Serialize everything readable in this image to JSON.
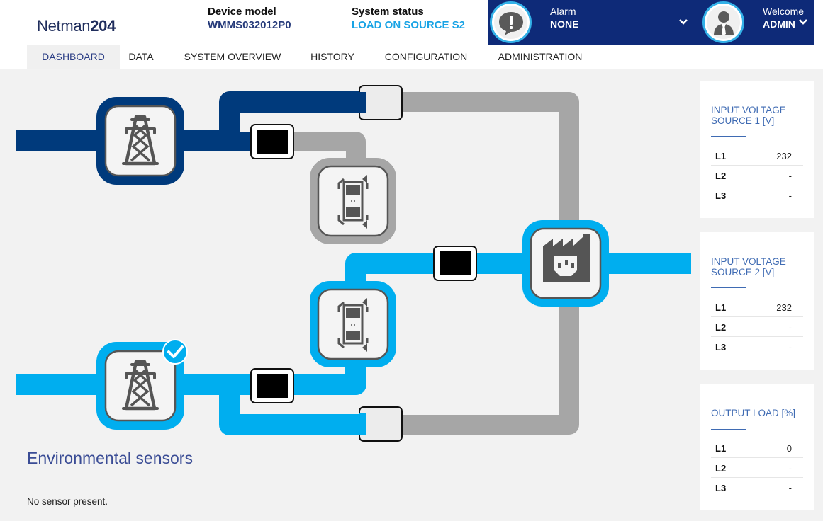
{
  "header": {
    "logo_main": "Netman",
    "logo_bold": "204",
    "device_model_label": "Device model",
    "device_model_value": "WMMS032012P0",
    "system_status_label": "System status",
    "system_status_value": "LOAD ON SOURCE S2",
    "alarm_label": "Alarm",
    "alarm_value": "NONE",
    "welcome_label": "Welcome",
    "user_value": "ADMIN"
  },
  "nav": {
    "tabs": [
      {
        "label": "DASHBOARD",
        "active": true
      },
      {
        "label": "DATA"
      },
      {
        "label": "SYSTEM OVERVIEW"
      },
      {
        "label": "HISTORY"
      },
      {
        "label": "CONFIGURATION"
      },
      {
        "label": "ADMINISTRATION"
      }
    ]
  },
  "panels": [
    {
      "title_line1": "INPUT VOLTAGE",
      "title_line2": "SOURCE 1 [V]",
      "rows": [
        {
          "k": "L1",
          "v": "232"
        },
        {
          "k": "L2",
          "v": "-"
        },
        {
          "k": "L3",
          "v": "-"
        }
      ]
    },
    {
      "title_line1": "INPUT VOLTAGE",
      "title_line2": "SOURCE 2 [V]",
      "rows": [
        {
          "k": "L1",
          "v": "232"
        },
        {
          "k": "L2",
          "v": "-"
        },
        {
          "k": "L3",
          "v": "-"
        }
      ]
    },
    {
      "title_line1": "OUTPUT LOAD [%]",
      "title_line2": "",
      "rows": [
        {
          "k": "L1",
          "v": "0"
        },
        {
          "k": "L2",
          "v": "-"
        },
        {
          "k": "L3",
          "v": "-"
        }
      ]
    }
  ],
  "environment": {
    "title": "Environmental sensors",
    "message": "No sensor present."
  },
  "colors": {
    "source1": "#003a7c",
    "source2": "#00aeef",
    "inactive": "#a6a6a6",
    "header_bar": "#0e2a78"
  },
  "icons": {
    "alarm": "alarm-bubble-icon",
    "user": "user-avatar-icon",
    "tower": "power-tower-icon",
    "sts": "static-transfer-switch-icon",
    "load": "factory-plug-icon",
    "check": "check-icon"
  }
}
